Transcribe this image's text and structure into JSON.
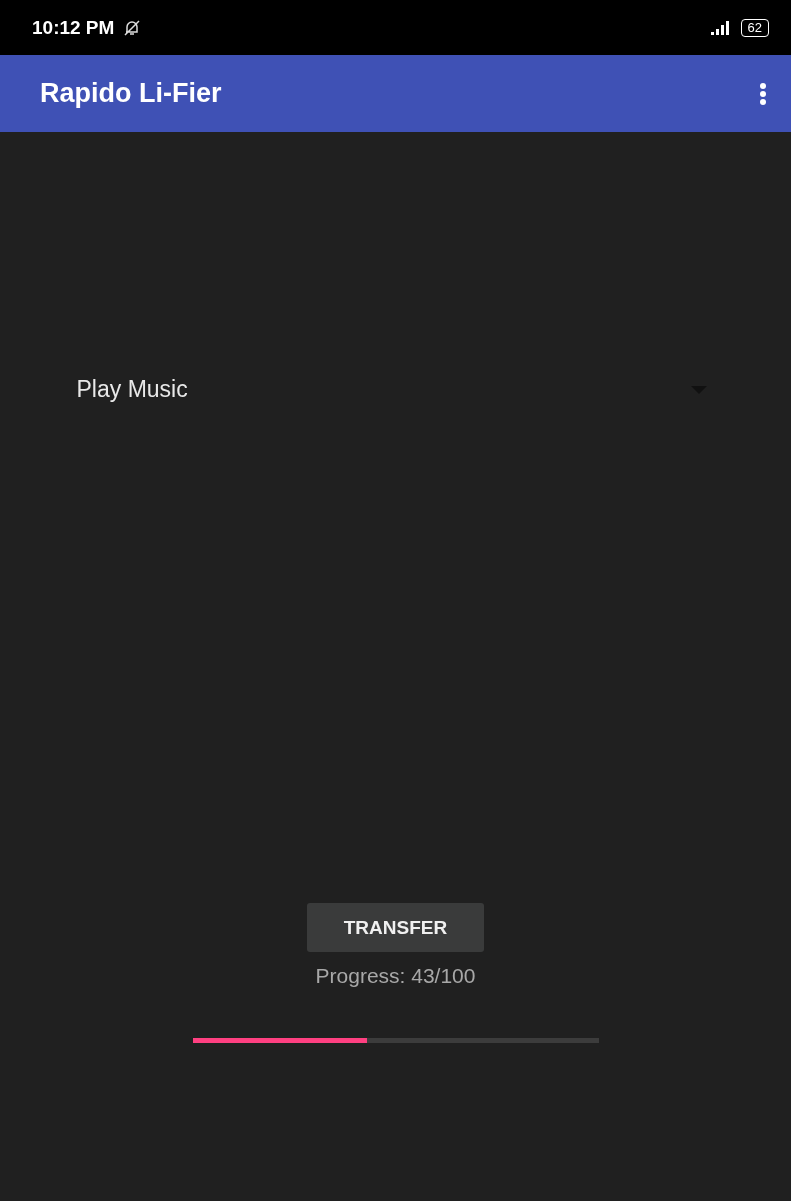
{
  "status_bar": {
    "time": "10:12 PM",
    "battery": "62"
  },
  "app_bar": {
    "title": "Rapido Li-Fier"
  },
  "spinner": {
    "value": "Play Music"
  },
  "transfer_button": {
    "label": "TRANSFER"
  },
  "progress": {
    "label": "Progress: 43/100",
    "level": 0.43
  }
}
